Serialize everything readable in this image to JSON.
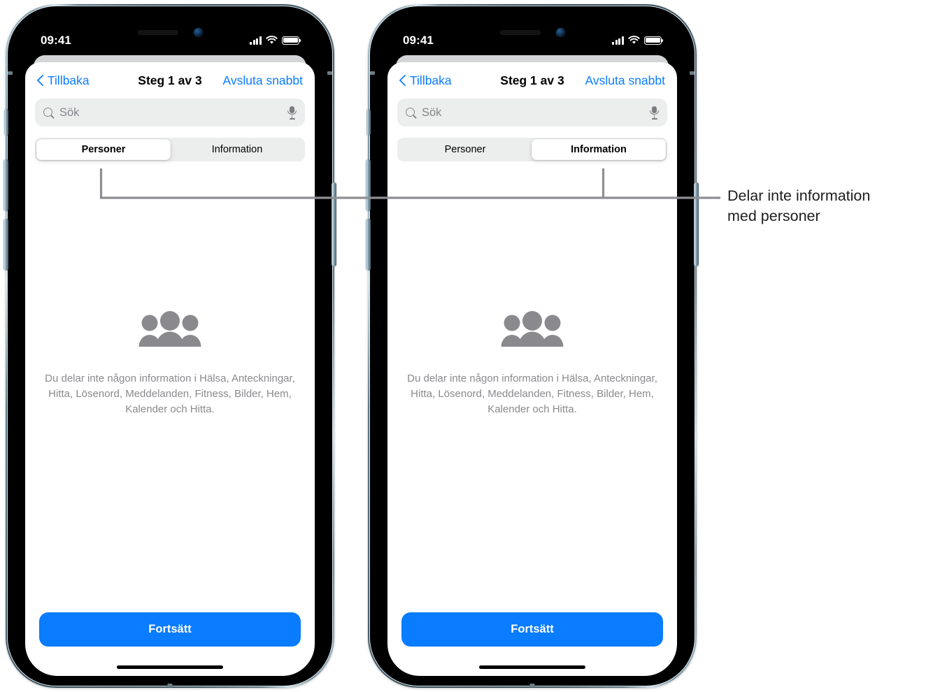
{
  "phones": [
    {
      "id": "phone-left",
      "status": {
        "time": "09:41",
        "cellular": "cellular-bars-icon",
        "wifi": "wifi-icon",
        "battery": "battery-icon"
      },
      "nav": {
        "back": "Tillbaka",
        "title": "Steg 1 av 3",
        "right": "Avsluta snabbt"
      },
      "search": {
        "placeholder": "Sök",
        "search_icon": "search-icon",
        "mic_icon": "microphone-icon"
      },
      "segments": [
        {
          "label": "Personer",
          "active": true
        },
        {
          "label": "Information",
          "active": false
        }
      ],
      "empty": {
        "icon": "people-group-icon",
        "text": "Du delar inte någon information i Hälsa, Anteckningar, Hitta, Lösenord, Meddelanden, Fitness, Bilder, Hem, Kalender och Hitta."
      },
      "cta": "Fortsätt"
    },
    {
      "id": "phone-right",
      "status": {
        "time": "09:41",
        "cellular": "cellular-bars-icon",
        "wifi": "wifi-icon",
        "battery": "battery-icon"
      },
      "nav": {
        "back": "Tillbaka",
        "title": "Steg 1 av 3",
        "right": "Avsluta snabbt"
      },
      "search": {
        "placeholder": "Sök",
        "search_icon": "search-icon",
        "mic_icon": "microphone-icon"
      },
      "segments": [
        {
          "label": "Personer",
          "active": false
        },
        {
          "label": "Information",
          "active": true
        }
      ],
      "empty": {
        "icon": "people-group-icon",
        "text": "Du delar inte någon information i Hälsa, Anteckningar, Hitta, Lösenord, Meddelanden, Fitness, Bilder, Hem, Kalender och Hitta."
      },
      "cta": "Fortsätt"
    }
  ],
  "callout": {
    "line1": "Delar inte information",
    "line2": "med personer"
  },
  "colors": {
    "accent": "#0a7cff",
    "control_background": "#eceded",
    "muted_text": "#8a8a8e",
    "callout_line": "#8e8e93",
    "sheet_back": "#d3d4d8"
  }
}
